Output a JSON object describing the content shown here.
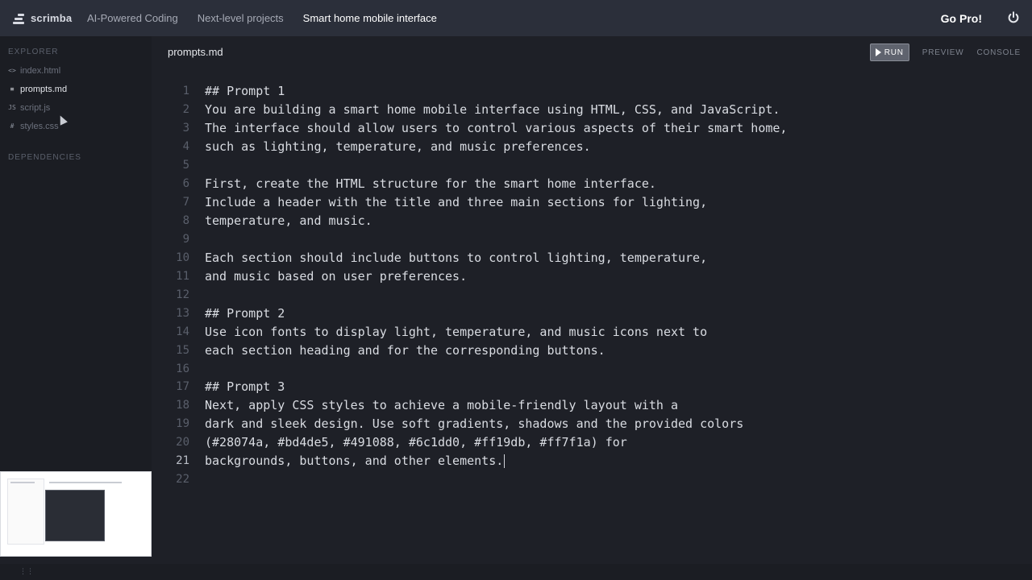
{
  "topbar": {
    "brand_name": "scrimba",
    "crumbs": [
      "AI-Powered Coding",
      "Next-level projects",
      "Smart home mobile interface"
    ],
    "go_pro_label": "Go Pro!",
    "power_icon": "power-icon"
  },
  "sidebar": {
    "explorer_title": "EXPLORER",
    "files": [
      {
        "icon": "<>",
        "name": "index.html",
        "active": false
      },
      {
        "icon": "≡",
        "name": "prompts.md",
        "active": true
      },
      {
        "icon": "JS",
        "name": "script.js",
        "active": false
      },
      {
        "icon": "#",
        "name": "styles.css",
        "active": false
      }
    ],
    "dependencies_title": "DEPENDENCIES"
  },
  "editor": {
    "filename": "prompts.md",
    "run_label": "RUN",
    "preview_label": "PREVIEW",
    "console_label": "CONSOLE",
    "current_line": 21,
    "lines": [
      "## Prompt 1",
      "You are building a smart home mobile interface using HTML, CSS, and JavaScript.",
      "The interface should allow users to control various aspects of their smart home,",
      "such as lighting, temperature, and music preferences.",
      "",
      "First, create the HTML structure for the smart home interface.",
      "Include a header with the title and three main sections for lighting,",
      "temperature, and music.",
      "",
      "Each section should include buttons to control lighting, temperature,",
      "and music based on user preferences.",
      "",
      "## Prompt 2",
      "Use icon fonts to display light, temperature, and music icons next to",
      "each section heading and for the corresponding buttons.",
      "",
      "## Prompt 3",
      "Next, apply CSS styles to achieve a mobile-friendly layout with a",
      "dark and sleek design. Use soft gradients, shadows and the provided colors",
      "(#28074a, #bd4de5, #491088, #6c1dd0, #ff19db, #ff7f1a) for",
      "backgrounds, buttons, and other elements.",
      ""
    ]
  },
  "colors": {
    "topbar_bg": "#2b2f3a",
    "sidebar_bg": "#1b1d23",
    "editor_bg": "#1e2027"
  }
}
